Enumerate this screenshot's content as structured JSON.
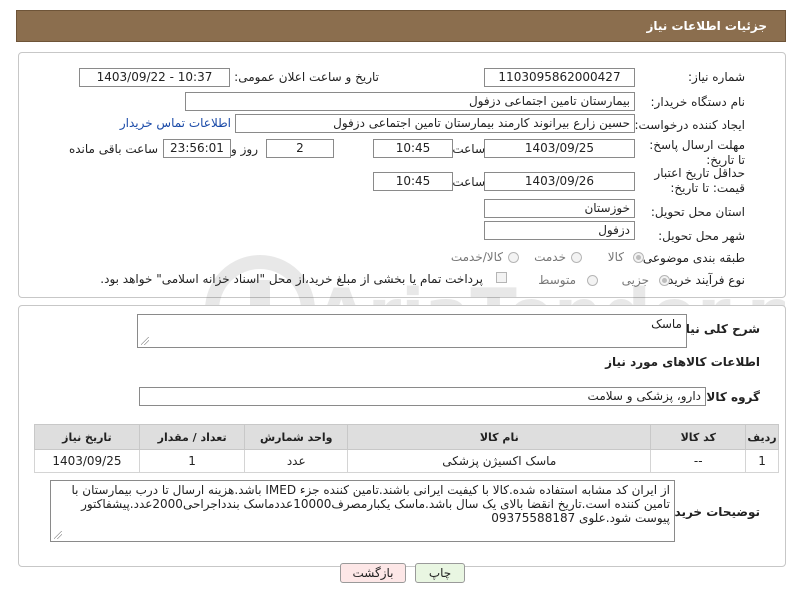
{
  "header": {
    "title": "جزئیات اطلاعات نیاز"
  },
  "form": {
    "need_number_label": "شماره نیاز:",
    "need_number": "1103095862000427",
    "announce_label": "تاریخ و ساعت اعلان عمومی:",
    "announce_value": "1403/09/22 - 10:37",
    "buyer_org_label": "نام دستگاه خریدار:",
    "buyer_org": "بیمارستان تامین اجتماعی دزفول",
    "creator_label": "ایجاد کننده درخواست:",
    "creator": "حسین زارع بیرانوند کارمند بیمارستان تامین اجتماعی دزفول",
    "contact_link": "اطلاعات تماس خریدار",
    "reply_deadline_label": "مهلت ارسال پاسخ: تا تاریخ:",
    "reply_date": "1403/09/25",
    "time_label": "ساعت",
    "reply_time": "10:45",
    "days_value": "2",
    "days_label": "روز و",
    "remaining_value": "23:56:01",
    "remaining_label": "ساعت باقی مانده",
    "price_validity_label": "حداقل تاریخ اعتبار قیمت: تا تاریخ:",
    "price_date": "1403/09/26",
    "price_time": "10:45",
    "province_label": "استان محل تحویل:",
    "province": "خوزستان",
    "city_label": "شهر محل تحویل:",
    "city": "دزفول",
    "category_label": "طبقه بندی موضوعی:",
    "category_options": [
      "کالا",
      "خدمت",
      "کالا/خدمت"
    ],
    "process_label": "نوع فرآیند خرید :",
    "process_options": [
      "جزیی",
      "متوسط"
    ],
    "payment_note": "پرداخت تمام یا بخشی از مبلغ خرید،از محل \"اسناد خزانه اسلامی\" خواهد بود."
  },
  "summary": {
    "title_label": "شرح کلی نیاز:",
    "title_value": "ماسک",
    "goods_info_title": "اطلاعات کالاهای مورد نیاز",
    "group_label": "گروه کالا:",
    "group_value": "دارو، پزشکی و سلامت"
  },
  "table": {
    "headers": [
      "ردیف",
      "کد کالا",
      "نام کالا",
      "واحد شمارش",
      "تعداد / مقدار",
      "تاریخ نیاز"
    ],
    "rows": [
      [
        "1",
        "--",
        "ماسک اکسیژن پزشکی",
        "عدد",
        "1",
        "1403/09/25"
      ]
    ]
  },
  "notes": {
    "label": "توضیحات خریدار:",
    "text": "از ایران کد مشابه استفاده شده.کالا با کیفیت ایرانی باشند.تامین کننده جزء IMED باشد.هزینه ارسال تا درب بیمارستان با تامین کننده است.تاریخ انقضا بالای یک سال باشد.ماسک یکبارمصرف10000عددماسک بندداجراحی2000عدد.پیشفاکتور پیوست شود.علوی 09375588187"
  },
  "buttons": {
    "print": "چاپ",
    "back": "بازگشت"
  },
  "watermark": {
    "text": "AriaTender.neT"
  },
  "colors": {
    "header": "#8b6e4e",
    "link": "#1a4aa8",
    "back_button": "#fde7e7",
    "print_button": "#e9f6e2"
  }
}
